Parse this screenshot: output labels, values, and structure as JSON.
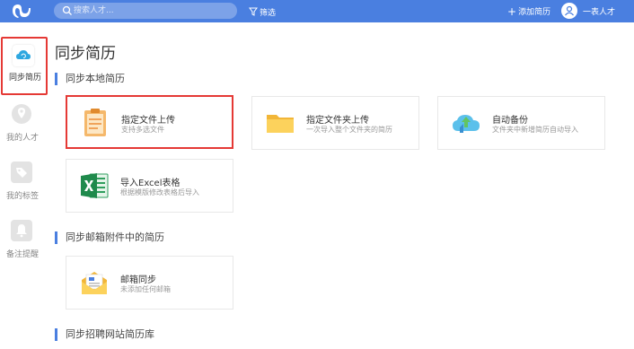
{
  "header": {
    "search_placeholder": "搜索人才...",
    "filter_label": "筛选",
    "add_resume_label": "添加简历",
    "user_name": "一表人才",
    "accent": "#4a7fe0"
  },
  "sidebar": {
    "items": [
      {
        "label": "同步简历",
        "icon": "cloud-sync-icon",
        "active": true
      },
      {
        "label": "我的人才",
        "icon": "location-pin-icon",
        "active": false
      },
      {
        "label": "我的标签",
        "icon": "tag-icon",
        "active": false
      },
      {
        "label": "备注提醒",
        "icon": "bell-icon",
        "active": false
      }
    ]
  },
  "main": {
    "title": "同步简历",
    "sections": [
      {
        "heading": "同步本地简历"
      },
      {
        "heading": "同步邮箱附件中的简历"
      },
      {
        "heading": "同步招聘网站简历库"
      }
    ],
    "cards": {
      "upload_file": {
        "title": "指定文件上传",
        "subtitle": "支持多选文件",
        "icon": "document-icon"
      },
      "upload_folder": {
        "title": "指定文件夹上传",
        "subtitle": "一次导入整个文件夹的简历",
        "icon": "folder-icon"
      },
      "auto_backup": {
        "title": "自动备份",
        "subtitle": "文件夹中新增简历自动导入",
        "icon": "cloud-upload-icon"
      },
      "import_excel": {
        "title": "导入Excel表格",
        "subtitle": "根据模版修改表格后导入",
        "icon": "excel-icon"
      },
      "mail_sync": {
        "title": "邮箱同步",
        "subtitle": "未添加任何邮箱",
        "icon": "envelope-icon"
      }
    }
  }
}
